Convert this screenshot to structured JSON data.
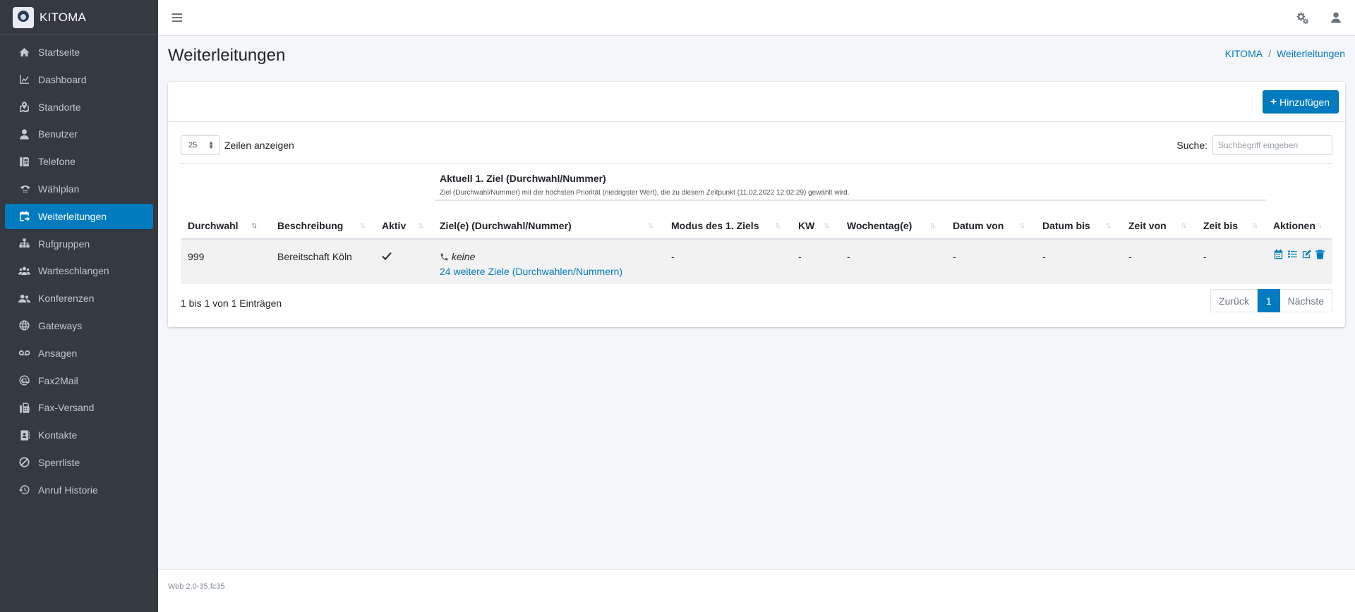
{
  "brand": {
    "name": "KITOMA"
  },
  "sidebar": {
    "items": [
      {
        "label": "Startseite",
        "icon": "home-icon"
      },
      {
        "label": "Dashboard",
        "icon": "chart-line-icon"
      },
      {
        "label": "Standorte",
        "icon": "map-marked-icon"
      },
      {
        "label": "Benutzer",
        "icon": "user-icon"
      },
      {
        "label": "Telefone",
        "icon": "fax-phone-icon"
      },
      {
        "label": "Wählplan",
        "icon": "dialpad-icon"
      },
      {
        "label": "Weiterleitungen",
        "icon": "calendar-forward-icon",
        "active": true
      },
      {
        "label": "Rufgruppen",
        "icon": "sitemap-icon"
      },
      {
        "label": "Warteschlangen",
        "icon": "users-queue-icon"
      },
      {
        "label": "Konferenzen",
        "icon": "user-friends-icon"
      },
      {
        "label": "Gateways",
        "icon": "globe-icon"
      },
      {
        "label": "Ansagen",
        "icon": "voicemail-icon"
      },
      {
        "label": "Fax2Mail",
        "icon": "at-icon"
      },
      {
        "label": "Fax-Versand",
        "icon": "fax-icon"
      },
      {
        "label": "Kontakte",
        "icon": "address-book-icon"
      },
      {
        "label": "Sperrliste",
        "icon": "ban-icon"
      },
      {
        "label": "Anruf Historie",
        "icon": "history-icon"
      }
    ]
  },
  "header": {
    "title": "Weiterleitungen",
    "breadcrumb": [
      "KITOMA",
      "Weiterleitungen"
    ],
    "separator": "/"
  },
  "toolbar": {
    "add_label": "Hinzufügen",
    "length_value": "25",
    "length_label": "Zeilen anzeigen",
    "search_label": "Suche:",
    "search_placeholder": "Suchbegriff eingeben"
  },
  "table": {
    "group_title": "Aktuell 1. Ziel (Durchwahl/Nummer)",
    "group_subtitle": "Ziel (Durchwahl/Nummer) mit der höchsten Priorität (niedrigster Wert), die zu diesem Zeitpunkt (11.02.2022 12:02:29) gewählt wird.",
    "columns": [
      "Durchwahl",
      "Beschreibung",
      "Aktiv",
      "Ziel(e) (Durchwahl/Nummer)",
      "Modus des 1. Ziels",
      "KW",
      "Wochentag(e)",
      "Datum von",
      "Datum bis",
      "Zeit von",
      "Zeit bis",
      "Aktionen"
    ],
    "rows": [
      {
        "durchwahl": "999",
        "beschreibung": "Bereitschaft Köln",
        "aktiv": true,
        "ziel": "keine",
        "weitere": "24 weitere Ziele (Durchwahlen/Nummern)",
        "modus": "-",
        "kw": "-",
        "wochentag": "-",
        "datum_von": "-",
        "datum_bis": "-",
        "zeit_von": "-",
        "zeit_bis": "-"
      }
    ],
    "info": "1 bis 1 von 1 Einträgen"
  },
  "pagination": {
    "prev": "Zurück",
    "current": "1",
    "next": "Nächste"
  },
  "footer": {
    "version": "Web 2.0-35.fc35"
  },
  "colors": {
    "accent": "#007bbf",
    "sidebar": "#343a40"
  }
}
